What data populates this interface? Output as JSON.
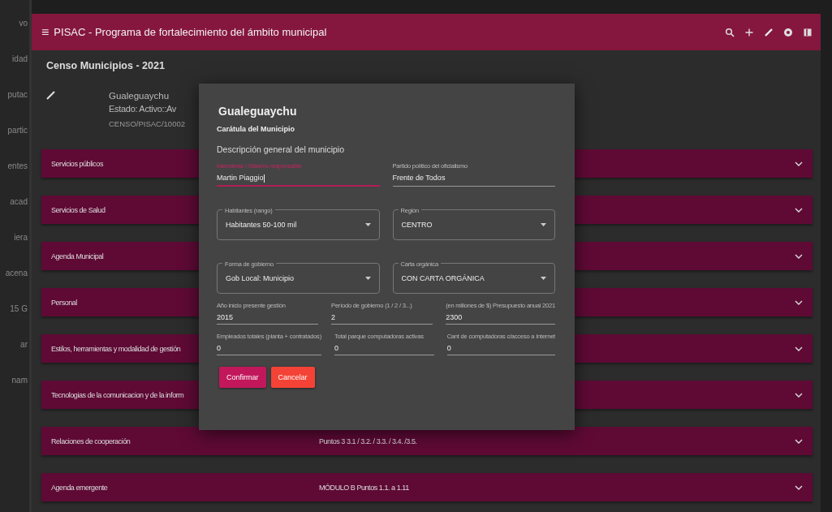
{
  "side_fragments": [
    "vo",
    "idad",
    "putac",
    "partic",
    "entes",
    "acad",
    "iera",
    "acena",
    "15 G",
    "ar",
    "nam"
  ],
  "app_bar": {
    "menu_glyph": "≡",
    "title": "PISAC - Programa de fortalecimiento del ámbito municipal"
  },
  "page_title": "Censo Municipios - 2021",
  "record": {
    "name": "Gualeguaychu",
    "status": "Estado: Activo::Av",
    "code": "CENSO/PISAC/10002"
  },
  "sections": [
    {
      "title": "Servicios públicos"
    },
    {
      "title": "Servicios de Salud"
    },
    {
      "title": "Agenda Municipal"
    },
    {
      "title": "Personal"
    },
    {
      "title": "Estilos, herramientas y modalidad de gestión"
    },
    {
      "title": "Tecnologias de la comunicacion y de la inform"
    },
    {
      "title": "Relaciones de cooperación",
      "detail": "Puntos 3 3.1 / 3.2. / 3.3. / 3.4. /3.5."
    },
    {
      "title": "Agenda emergente",
      "detail": "MÓDULO B Puntos 1.1. a 1.11"
    }
  ],
  "dialog": {
    "title": "Gualeguaychu",
    "subtitle": "Carátula del Municipio",
    "section": "Descripción general del municipio",
    "rows": [
      [
        {
          "kind": "text",
          "label": "Intendente / Máximo responsable",
          "value": "Martin Piaggio",
          "focused": true
        },
        {
          "kind": "text",
          "label": "Partido político del oficialismo",
          "value": "Frente de Todos",
          "focused": false
        }
      ],
      [
        {
          "kind": "select",
          "label": "Habitantes (rango)",
          "value": "Habitantes 50-100 mil"
        },
        {
          "kind": "select",
          "label": "Región",
          "value": "CENTRO"
        }
      ],
      [
        {
          "kind": "select",
          "label": "Forma de gobierno",
          "value": "Gob Local: Municipio"
        },
        {
          "kind": "select",
          "label": "Carta orgánica",
          "value": "CON CARTA ORGÁNICA"
        }
      ],
      [
        {
          "kind": "text",
          "label": "Año inicio presente gestión",
          "value": "2015",
          "focused": false
        },
        {
          "kind": "text",
          "label": "Período de gobierno (1 / 2 / 3...)",
          "value": "2",
          "focused": false
        },
        {
          "kind": "text",
          "label": "(en millones de $) Presupuesto anual 2021",
          "value": "2300",
          "focused": false
        }
      ],
      [
        {
          "kind": "text",
          "label": "Empleados totales (planta + contratados)",
          "value": "0",
          "focused": false
        },
        {
          "kind": "text",
          "label": "Total parque computadoras activas",
          "value": "0",
          "focused": false
        },
        {
          "kind": "text",
          "label": "Cant de computadoras c/acceso a Internet",
          "value": "0",
          "focused": false
        }
      ]
    ],
    "buttons": [
      {
        "label": "Confirmar",
        "kind": "primary"
      },
      {
        "label": "Cancelar",
        "kind": "danger"
      }
    ]
  }
}
